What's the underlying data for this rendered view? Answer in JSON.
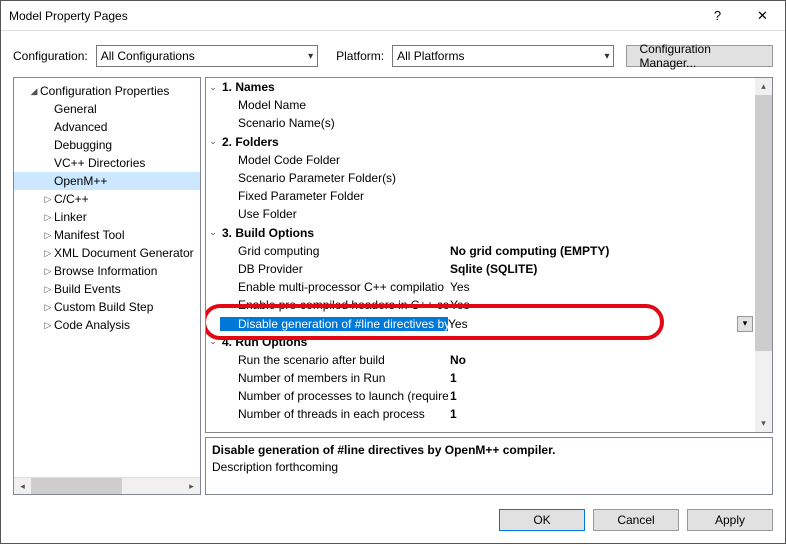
{
  "window": {
    "title": "Model Property Pages",
    "help_glyph": "?",
    "close_glyph": "✕"
  },
  "configRow": {
    "configuration_label": "Configuration:",
    "configuration_value": "All Configurations",
    "platform_label": "Platform:",
    "platform_value": "All Platforms",
    "manager_button": "Configuration Manager..."
  },
  "tree": {
    "root": "Configuration Properties",
    "items": [
      {
        "label": "General",
        "twist": null
      },
      {
        "label": "Advanced",
        "twist": null
      },
      {
        "label": "Debugging",
        "twist": null
      },
      {
        "label": "VC++ Directories",
        "twist": null
      },
      {
        "label": "OpenM++",
        "twist": null,
        "selected": true
      },
      {
        "label": "C/C++",
        "twist": "▷"
      },
      {
        "label": "Linker",
        "twist": "▷"
      },
      {
        "label": "Manifest Tool",
        "twist": "▷"
      },
      {
        "label": "XML Document Generator",
        "twist": "▷"
      },
      {
        "label": "Browse Information",
        "twist": "▷"
      },
      {
        "label": "Build Events",
        "twist": "▷"
      },
      {
        "label": "Custom Build Step",
        "twist": "▷"
      },
      {
        "label": "Code Analysis",
        "twist": "▷"
      }
    ]
  },
  "grid": {
    "rows": [
      {
        "kind": "section",
        "twist": "⌄",
        "label": "1. Names"
      },
      {
        "kind": "prop",
        "label": "Model Name",
        "value": ""
      },
      {
        "kind": "prop",
        "label": "Scenario Name(s)",
        "value": ""
      },
      {
        "kind": "section",
        "twist": "⌄",
        "label": "2. Folders"
      },
      {
        "kind": "prop",
        "label": "Model Code Folder",
        "value": ""
      },
      {
        "kind": "prop",
        "label": "Scenario Parameter Folder(s)",
        "value": ""
      },
      {
        "kind": "prop",
        "label": "Fixed Parameter Folder",
        "value": ""
      },
      {
        "kind": "prop",
        "label": "Use Folder",
        "value": ""
      },
      {
        "kind": "section",
        "twist": "⌄",
        "label": "3. Build Options"
      },
      {
        "kind": "prop",
        "label": "Grid computing",
        "value": "No grid computing (EMPTY)",
        "bold": true
      },
      {
        "kind": "prop",
        "label": "DB Provider",
        "value": "Sqlite (SQLITE)",
        "bold": true
      },
      {
        "kind": "prop",
        "label": "Enable multi-processor C++ compilatio",
        "value": "Yes"
      },
      {
        "kind": "prop",
        "label": "Enable pre-compiled headers in C++ co",
        "value": "Yes"
      },
      {
        "kind": "prop",
        "label": "Disable generation of #line directives by",
        "value": "Yes",
        "selected": true,
        "combo": true
      },
      {
        "kind": "section",
        "twist": "⌄",
        "label": "4. Run Options"
      },
      {
        "kind": "prop",
        "label": "Run the scenario after build",
        "value": "No",
        "bold": true
      },
      {
        "kind": "prop",
        "label": "Number of members in Run",
        "value": "1",
        "bold": true
      },
      {
        "kind": "prop",
        "label": "Number of processes to launch (require",
        "value": "1",
        "bold": true
      },
      {
        "kind": "prop",
        "label": "Number of threads in each process",
        "value": "1",
        "bold": true
      }
    ]
  },
  "description": {
    "title": "Disable generation of #line directives by OpenM++ compiler.",
    "body": "Description forthcoming"
  },
  "footer": {
    "ok": "OK",
    "cancel": "Cancel",
    "apply": "Apply"
  }
}
